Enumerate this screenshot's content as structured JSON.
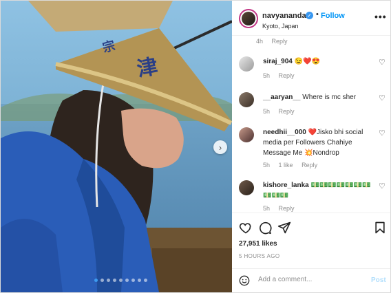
{
  "header": {
    "username": "navyananda",
    "separator": "•",
    "follow_label": "Follow",
    "location": "Kyoto, Japan",
    "more_icon": "•••"
  },
  "caption_meta": {
    "time": "4h",
    "reply": "Reply"
  },
  "comments": [
    {
      "user": "siraj_904",
      "text": "😉❤️😍",
      "time": "5h",
      "likes": "",
      "reply": "Reply"
    },
    {
      "user": "__aaryan__",
      "text": "Where is mc sher",
      "time": "5h",
      "likes": "",
      "reply": "Reply"
    },
    {
      "user": "needhii__000",
      "text": "❤️Jisko bhi social media per Followers Chahiye Message Me 💥Nondrop",
      "time": "5h",
      "likes": "1 like",
      "reply": "Reply"
    },
    {
      "user": "kishore_lanka",
      "text": "💵💵💵💵💵💵💵💵💵💵",
      "time": "5h",
      "likes": "",
      "reply": "Reply"
    }
  ],
  "post": {
    "likes": "27,951 likes",
    "time": "5 HOURS AGO",
    "carousel_dots": 9,
    "active_dot": 0
  },
  "add_comment": {
    "placeholder": "Add a comment...",
    "post_label": "Post"
  },
  "icons": {
    "like": "heart-icon",
    "comment": "comment-icon",
    "share": "paper-plane-icon",
    "save": "bookmark-icon",
    "emoji": "emoji-icon",
    "next": "chevron-right-icon"
  },
  "colors": {
    "accent": "#0095f6",
    "verified": "#3897f0",
    "post_disabled": "#b2dffc"
  }
}
